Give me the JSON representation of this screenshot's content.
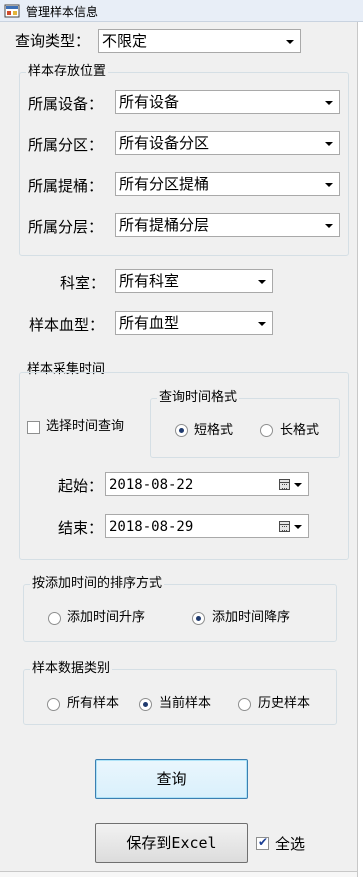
{
  "window": {
    "title": "管理样本信息"
  },
  "query_type": {
    "label": "查询类型：",
    "value": "不限定"
  },
  "storage": {
    "legend": "样本存放位置",
    "rows": [
      {
        "label": "所属设备：",
        "value": "所有设备"
      },
      {
        "label": "所属分区：",
        "value": "所有设备分区"
      },
      {
        "label": "所属提桶：",
        "value": "所有分区提桶"
      },
      {
        "label": "所属分层：",
        "value": "所有提桶分层"
      }
    ]
  },
  "department": {
    "label": "科室：",
    "value": "所有科室"
  },
  "blood_type": {
    "label": "样本血型：",
    "value": "所有血型"
  },
  "collection_time": {
    "legend": "样本采集时间",
    "use_time_query": {
      "label": "选择时间查询",
      "checked": false
    },
    "format": {
      "legend": "查询时间格式",
      "short": {
        "label": "短格式",
        "selected": true
      },
      "long": {
        "label": "长格式",
        "selected": false
      }
    },
    "start": {
      "label": "起始：",
      "value": "2018-08-22"
    },
    "end": {
      "label": "结束：",
      "value": "2018-08-29"
    }
  },
  "sort": {
    "legend": "按添加时间的排序方式",
    "asc": {
      "label": "添加时间升序",
      "selected": false
    },
    "desc": {
      "label": "添加时间降序",
      "selected": true
    }
  },
  "category": {
    "legend": "样本数据类别",
    "all": {
      "label": "所有样本",
      "selected": false
    },
    "current": {
      "label": "当前样本",
      "selected": true
    },
    "history": {
      "label": "历史样本",
      "selected": false
    }
  },
  "buttons": {
    "query": "查询",
    "save_excel": "保存到Excel"
  },
  "select_all": {
    "label": "全选",
    "checked": true
  },
  "colors": {
    "title_bar": "#e8eef7",
    "focus_border": "#3c7fb1",
    "radio_dot": "#1f3a6e",
    "check_mark": "#1c3f94"
  }
}
